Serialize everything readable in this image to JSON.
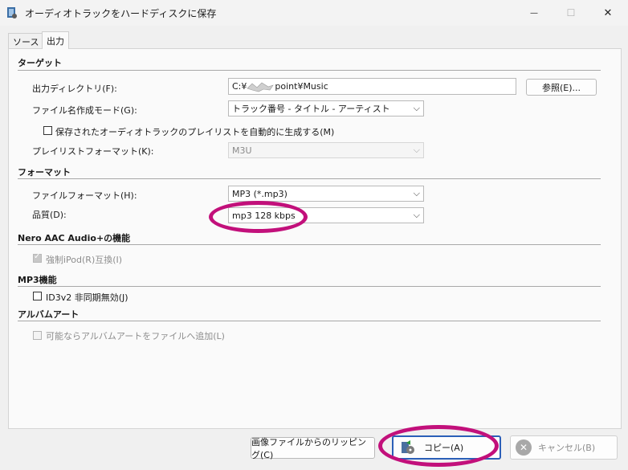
{
  "window": {
    "title": "オーディオトラックをハードディスクに保存",
    "minimize": "—",
    "maximize": "☐",
    "close": "✕"
  },
  "tabs": [
    {
      "label": "ソース"
    },
    {
      "label": "出力"
    }
  ],
  "target": {
    "heading": "ターゲット",
    "output_dir_label": "出力ディレクトリ(F):",
    "output_dir_value_start": "C:¥",
    "output_dir_value_end": "point¥Music",
    "browse_label": "参照(E)...",
    "filename_mode_label": "ファイル名作成モード(G):",
    "filename_mode_value": "トラック番号 - タイトル - アーティスト",
    "playlist_checkbox_label": "保存されたオーディオトラックのプレイリストを自動的に生成する(M)",
    "playlist_format_label": "プレイリストフォーマット(K):",
    "playlist_format_value": "M3U"
  },
  "format": {
    "heading": "フォーマット",
    "file_format_label": "ファイルフォーマット(H):",
    "file_format_value": "MP3 (*.mp3)",
    "quality_label": "品質(D):",
    "quality_value": "mp3 128 kbps"
  },
  "nero_aac": {
    "heading": "Nero AAC Audio+の機能",
    "ipod_label": "強制iPod(R)互換(I)",
    "ipod_checked": true
  },
  "mp3": {
    "heading": "MP3機能",
    "id3_label": "ID3v2 非同期無効(J)",
    "id3_checked": false
  },
  "album_art": {
    "heading": "アルバムアート",
    "add_art_label": "可能ならアルバムアートをファイルへ追加(L)"
  },
  "footer": {
    "rip_from_image_label": "画像ファイルからのリッピング(C)",
    "copy_label": "コピー(A)",
    "cancel_label": "キャンセル(B)"
  },
  "annotation_color": "#c2107b"
}
